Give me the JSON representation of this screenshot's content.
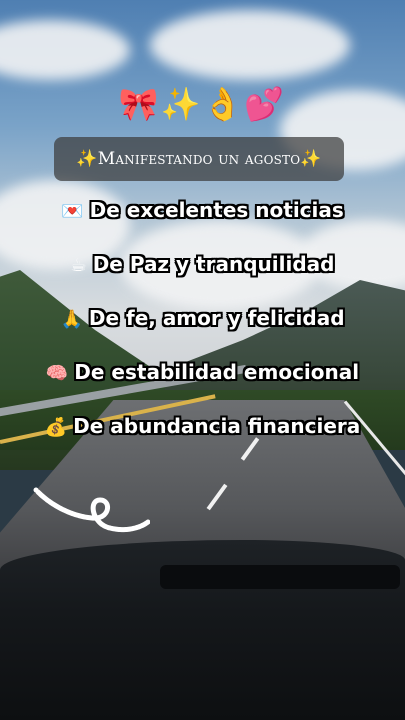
{
  "header": {
    "emojis": "🎀✨👌💕",
    "title": "✨Manifestando un agosto✨"
  },
  "lines": [
    {
      "icon": "💌",
      "icon_name": "love-letter-icon",
      "text": "De excelentes noticias"
    },
    {
      "icon": "☕",
      "icon_name": "coffee-icon",
      "text": "De Paz y tranquilidad"
    },
    {
      "icon": "🙏",
      "icon_name": "praying-hands-icon",
      "text": "De fe, amor y felicidad"
    },
    {
      "icon": "🧠",
      "icon_name": "brain-icon",
      "text": "De estabilidad emocional"
    },
    {
      "icon": "💰",
      "icon_name": "money-bag-icon",
      "text": "De abundancia financiera"
    }
  ],
  "colors": {
    "title_box": "#3c3c3c",
    "text": "#ffffff",
    "outline": "#000000"
  }
}
